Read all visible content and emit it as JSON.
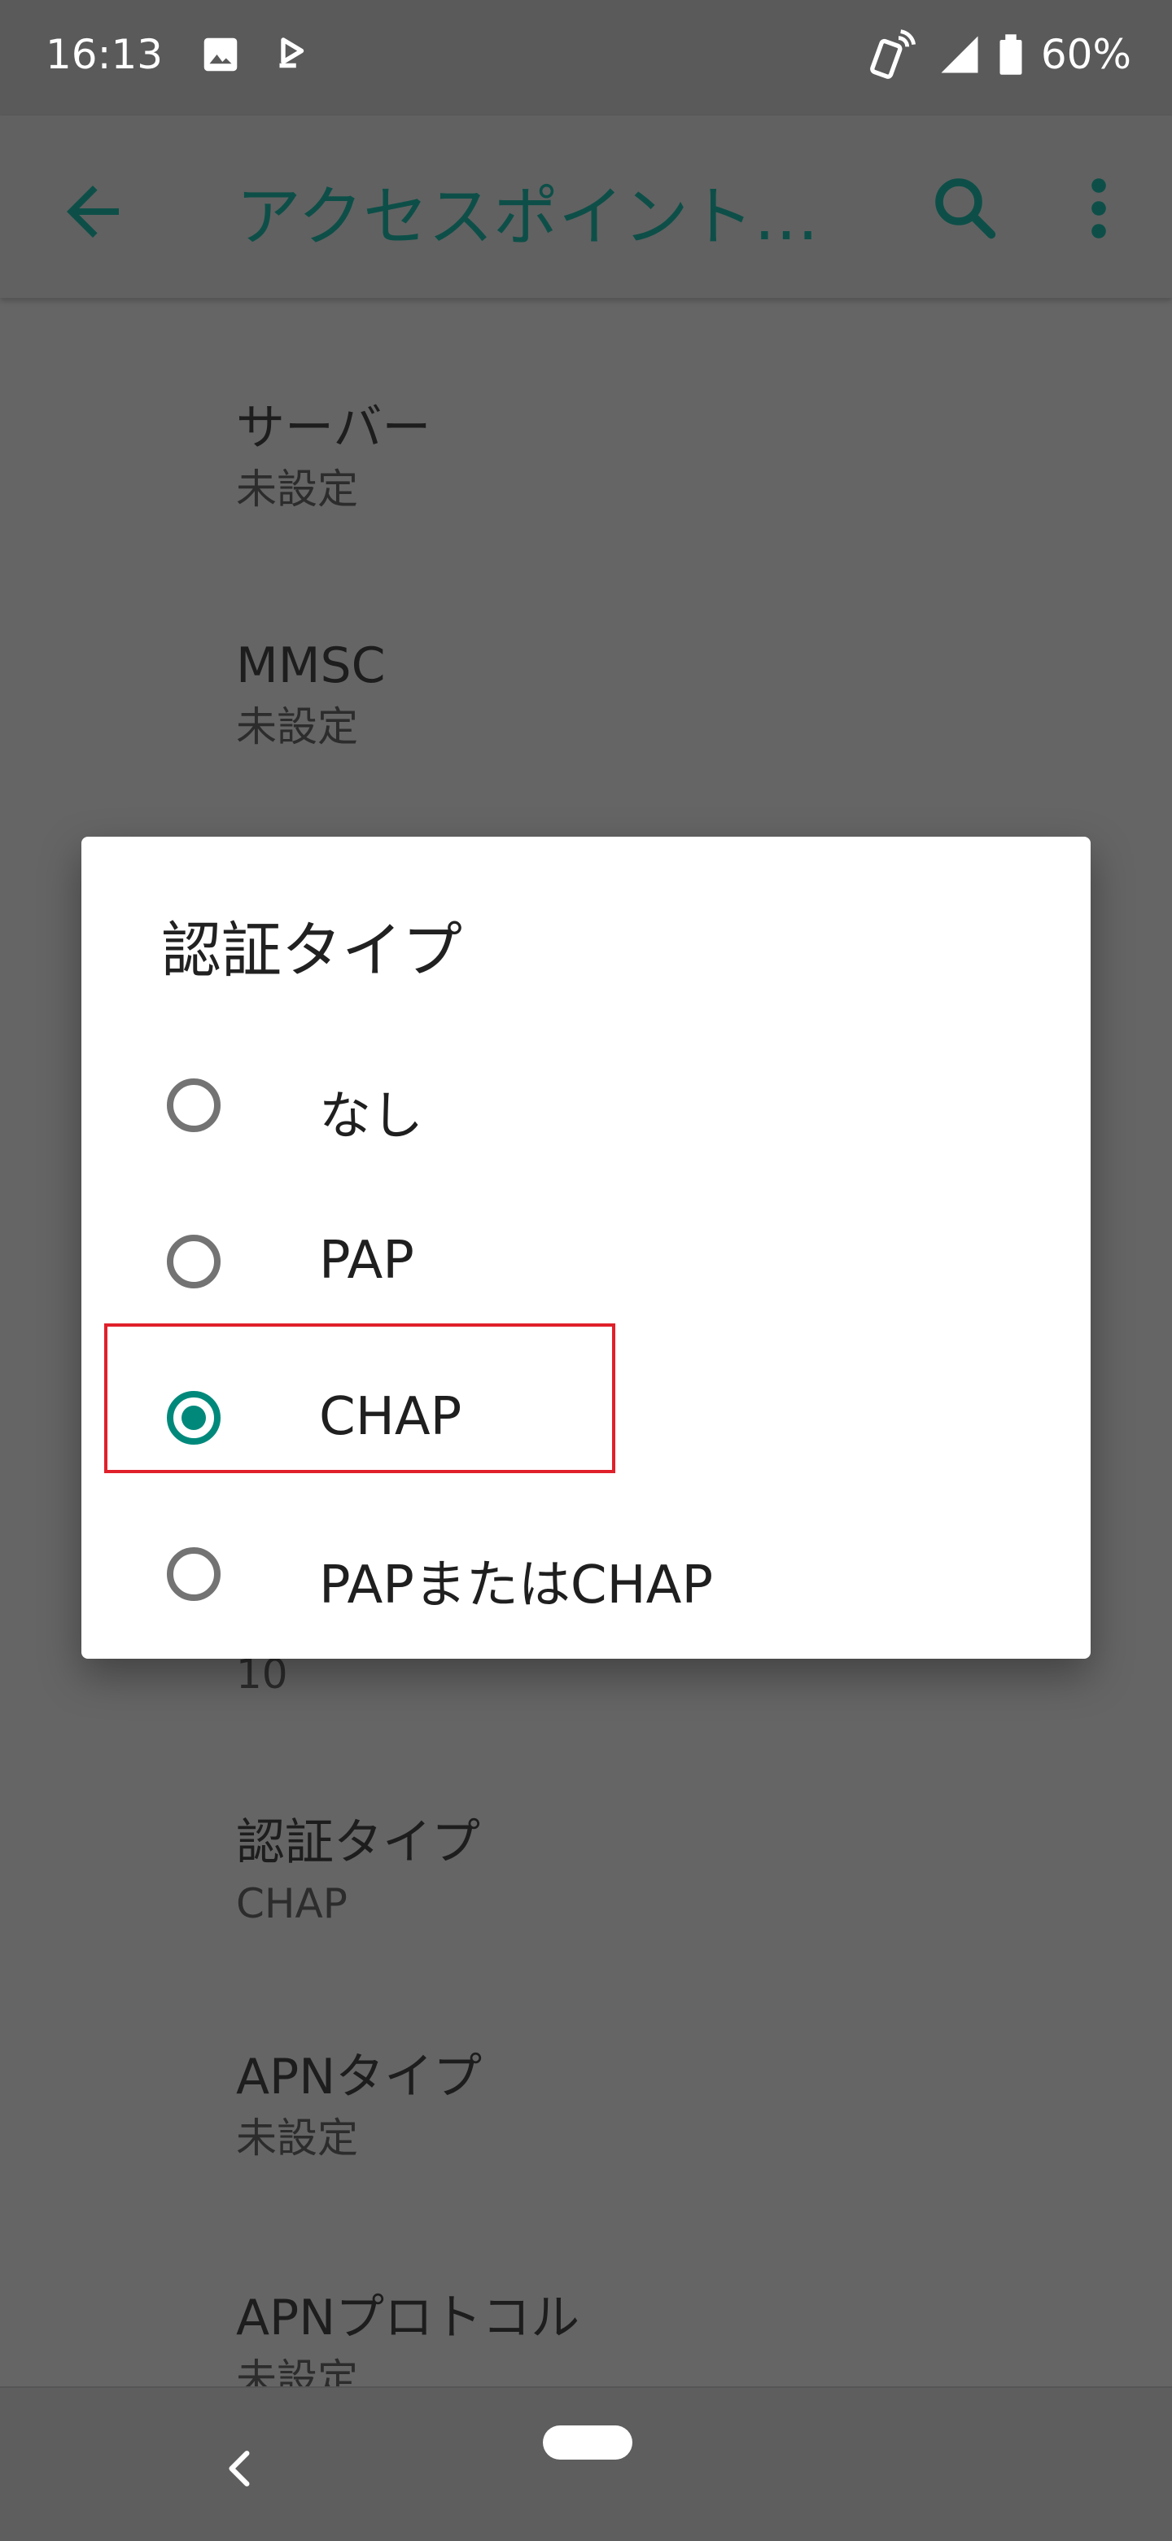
{
  "status_bar": {
    "time": "16:13",
    "battery": "60%",
    "icons": [
      "image-icon",
      "nfc-icon",
      "vibrate-icon",
      "signal-icon",
      "battery-icon"
    ]
  },
  "app_bar": {
    "title": "アクセスポイント…",
    "back_icon": "arrow-back-icon",
    "search_icon": "search-icon",
    "more_icon": "more-vert-icon"
  },
  "settings": {
    "server": {
      "title": "サーバー",
      "summary": "未設定"
    },
    "mmsc": {
      "title": "MMSC",
      "summary": "未設定"
    },
    "partial_value": "10",
    "auth_type": {
      "title": "認証タイプ",
      "summary": "CHAP"
    },
    "apn_type": {
      "title": "APNタイプ",
      "summary": "未設定"
    },
    "apn_protocol": {
      "title": "APNプロトコル",
      "summary": "未設定"
    }
  },
  "dialog": {
    "title": "認証タイプ",
    "options": [
      {
        "label": "なし",
        "checked": false
      },
      {
        "label": "PAP",
        "checked": false
      },
      {
        "label": "CHAP",
        "checked": true
      },
      {
        "label": "PAPまたはCHAP",
        "checked": false
      }
    ]
  },
  "colors": {
    "accent": "#00897b",
    "highlight": "#e0202a",
    "scrim_background": "#656565"
  }
}
